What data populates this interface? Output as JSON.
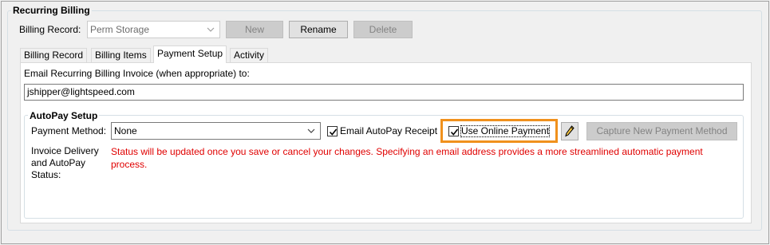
{
  "group_title": "Recurring Billing",
  "billing_record": {
    "label": "Billing Record:",
    "value": "Perm Storage",
    "buttons": {
      "new": "New",
      "rename": "Rename",
      "delete": "Delete"
    }
  },
  "tabs": [
    {
      "label": "Billing Record",
      "active": false
    },
    {
      "label": "Billing Items",
      "active": false
    },
    {
      "label": "Payment Setup",
      "active": true
    },
    {
      "label": "Activity",
      "active": false
    }
  ],
  "payment_setup": {
    "email_label": "Email Recurring Billing Invoice (when appropriate) to:",
    "email_value": "jshipper@lightspeed.com",
    "autopay": {
      "title": "AutoPay Setup",
      "payment_method_label": "Payment Method:",
      "payment_method_value": "None",
      "email_receipt_label": "Email AutoPay Receipt",
      "email_receipt_checked": true,
      "use_online_payment_label": "Use Online Payment",
      "use_online_payment_checked": true,
      "edit_icon": "pencil-icon",
      "capture_button": "Capture New Payment Method",
      "status_label": "Invoice Delivery and AutoPay Status:",
      "status_message": "Status will be updated once you save or cancel your changes.  Specifying an email address provides a more streamlined automatic payment process."
    }
  },
  "colors": {
    "highlight": "#f0911d",
    "status_text": "#e00000"
  }
}
